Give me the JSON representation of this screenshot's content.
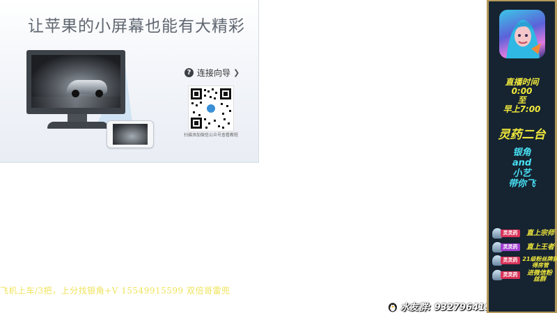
{
  "panel": {
    "title": "让苹果的小屏幕也能有大精彩",
    "guide_label": "连接向导",
    "qr_caption": "扫描添加微信公众号查看教程"
  },
  "ticker": {
    "text": "飞机上车/3把，上分找银角+V 15549915599  双倍哥雷兜"
  },
  "fan_group": {
    "text": "水友群: 932796419"
  },
  "sidebar": {
    "live_time_lines": [
      "直播时间",
      "0:00",
      "至",
      "早上7:00"
    ],
    "server_name": "灵药二台",
    "host_lines": [
      "银角",
      "and",
      "小艺",
      "带你飞"
    ],
    "rank_tag": "灵灵药",
    "ranks": [
      {
        "text": "直上宗师"
      },
      {
        "text": "直上王者"
      },
      {
        "text": "21级粉丝牌获得房管"
      },
      {
        "text": "进微信粉丝群"
      }
    ]
  },
  "colors": {
    "sidebar_bg": "#162331",
    "sidebar_border": "#b49a5a",
    "accent_yellow": "#f1ea3c",
    "accent_cyan": "#47e0f3",
    "ticker_yellow": "#efe35a"
  },
  "icons": [
    "help-icon",
    "chevron-right-icon",
    "qr-code",
    "penguin-icon",
    "game-logo",
    "rank-icon"
  ]
}
